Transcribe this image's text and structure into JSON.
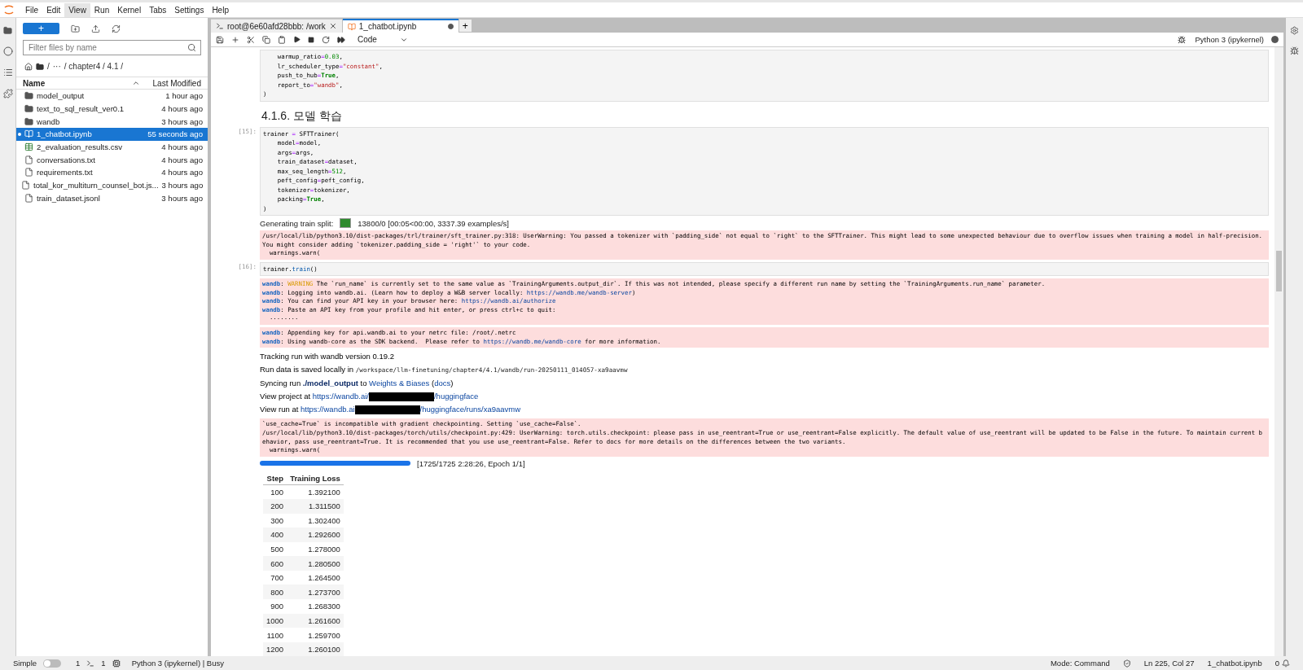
{
  "menu": [
    {
      "label": "File",
      "selected": false
    },
    {
      "label": "Edit",
      "selected": false
    },
    {
      "label": "View",
      "selected": true
    },
    {
      "label": "Run",
      "selected": false
    },
    {
      "label": "Kernel",
      "selected": false
    },
    {
      "label": "Tabs",
      "selected": false
    },
    {
      "label": "Settings",
      "selected": false
    },
    {
      "label": "Help",
      "selected": false
    }
  ],
  "file_browser": {
    "new_button": "+",
    "filter": {
      "placeholder": "Filter files by name"
    },
    "breadcrumb": [
      "/",
      "···",
      "/ chapter4 / 4.1 /"
    ],
    "columns": [
      "Name",
      "Last Modified"
    ],
    "files": [
      {
        "name": "model_output",
        "modified": "1 hour ago",
        "kind": "folder",
        "selected": false,
        "running": false
      },
      {
        "name": "text_to_sql_result_ver0.1",
        "modified": "4 hours ago",
        "kind": "folder",
        "selected": false,
        "running": false
      },
      {
        "name": "wandb",
        "modified": "3 hours ago",
        "kind": "folder",
        "selected": false,
        "running": false
      },
      {
        "name": "1_chatbot.ipynb",
        "modified": "55 seconds ago",
        "kind": "notebook",
        "selected": true,
        "running": true
      },
      {
        "name": "2_evaluation_results.csv",
        "modified": "4 hours ago",
        "kind": "csv",
        "selected": false,
        "running": false
      },
      {
        "name": "conversations.txt",
        "modified": "4 hours ago",
        "kind": "text",
        "selected": false,
        "running": false
      },
      {
        "name": "requirements.txt",
        "modified": "4 hours ago",
        "kind": "text",
        "selected": false,
        "running": false
      },
      {
        "name": "total_kor_multiturn_counsel_bot.js...",
        "modified": "3 hours ago",
        "kind": "text",
        "selected": false,
        "running": false
      },
      {
        "name": "train_dataset.jsonl",
        "modified": "3 hours ago",
        "kind": "text",
        "selected": false,
        "running": false
      }
    ]
  },
  "tabs": [
    {
      "label": "root@6e60afd28bbb: /work",
      "kind": "terminal",
      "selected": false,
      "dirty": false
    },
    {
      "label": "1_chatbot.ipynb",
      "kind": "notebook",
      "selected": true,
      "dirty": true
    }
  ],
  "add_tab": "+",
  "toolbar": {
    "cell_type": "Code",
    "kernel": "Python 3 (ipykernel)",
    "kernel_busy": true
  },
  "cells": [
    {
      "kind": "code",
      "lines": [
        [
          {
            "text": "    warmup_ratio",
            "kind": "name"
          },
          {
            "text": "=",
            "kind": "operator"
          },
          {
            "text": "0.03",
            "kind": "number"
          },
          {
            "text": ",",
            "kind": "name"
          }
        ],
        [
          {
            "text": "    lr_scheduler_type",
            "kind": "name"
          },
          {
            "text": "=",
            "kind": "operator"
          },
          {
            "text": "\"constant\"",
            "kind": "string"
          },
          {
            "text": ",",
            "kind": "name"
          }
        ],
        [
          {
            "text": "    push_to_hub",
            "kind": "name"
          },
          {
            "text": "=",
            "kind": "operator"
          },
          {
            "text": "True",
            "kind": "keyword"
          },
          {
            "text": ",",
            "kind": "name"
          }
        ],
        [
          {
            "text": "    report_to",
            "kind": "name"
          },
          {
            "text": "=",
            "kind": "operator"
          },
          {
            "text": "\"wandb\"",
            "kind": "string"
          },
          {
            "text": ",",
            "kind": "name"
          }
        ],
        [
          {
            "text": ")",
            "kind": "name"
          }
        ]
      ]
    },
    {
      "kind": "heading",
      "text": "4.1.6. 모델 학습"
    },
    {
      "kind": "code",
      "prompt": "[15]:",
      "lines": [
        [
          {
            "text": "trainer ",
            "kind": "name"
          },
          {
            "text": "=",
            "kind": "operator"
          },
          {
            "text": " SFTTrainer(",
            "kind": "name"
          }
        ],
        [
          {
            "text": "    model",
            "kind": "name"
          },
          {
            "text": "=",
            "kind": "operator"
          },
          {
            "text": "model,",
            "kind": "name"
          }
        ],
        [
          {
            "text": "    args",
            "kind": "name"
          },
          {
            "text": "=",
            "kind": "operator"
          },
          {
            "text": "args,",
            "kind": "name"
          }
        ],
        [
          {
            "text": "    train_dataset",
            "kind": "name"
          },
          {
            "text": "=",
            "kind": "operator"
          },
          {
            "text": "dataset,",
            "kind": "name"
          }
        ],
        [
          {
            "text": "    max_seq_length",
            "kind": "name"
          },
          {
            "text": "=",
            "kind": "operator"
          },
          {
            "text": "512",
            "kind": "number"
          },
          {
            "text": ",",
            "kind": "name"
          }
        ],
        [
          {
            "text": "    peft_config",
            "kind": "name"
          },
          {
            "text": "=",
            "kind": "operator"
          },
          {
            "text": "peft_config,",
            "kind": "name"
          }
        ],
        [
          {
            "text": "    tokenizer",
            "kind": "name"
          },
          {
            "text": "=",
            "kind": "operator"
          },
          {
            "text": "tokenizer,",
            "kind": "name"
          }
        ],
        [
          {
            "text": "    packing",
            "kind": "name"
          },
          {
            "text": "=",
            "kind": "operator"
          },
          {
            "text": "True",
            "kind": "keyword"
          },
          {
            "text": ",",
            "kind": "name"
          }
        ],
        [
          {
            "text": ")",
            "kind": "name"
          }
        ]
      ]
    },
    {
      "kind": "split_progress",
      "label": "Generating train split:",
      "level": 1,
      "text": "13800/0 [00:05<00:00, 3337.39 examples/s]"
    },
    {
      "kind": "stderr",
      "lines": [
        [
          {
            "text": "/usr/local/lib/python3.10/dist-packages/trl/trainer/sft_trainer.py:318: UserWarning: You passed a tokenizer with `padding_side` not equal to `right` to the SFTTrainer. This might lead to some unexpected behaviour due to overflow issues when training a model in half-precision.",
            "kind": "name"
          }
        ],
        [
          {
            "text": "You might consider adding `tokenizer.padding_side = 'right'` to your code.",
            "kind": "name"
          }
        ],
        [
          {
            "text": "  warnings.warn(",
            "kind": "name"
          }
        ]
      ]
    },
    {
      "kind": "code",
      "prompt": "[16]:",
      "lines": [
        [
          {
            "text": "trainer.",
            "kind": "name"
          },
          {
            "text": "train",
            "kind": "function"
          },
          {
            "text": "()",
            "kind": "name"
          }
        ]
      ]
    },
    {
      "kind": "stderr",
      "lines": [
        [
          {
            "text": "wandb",
            "kind": "wandb"
          },
          {
            "text": ": ",
            "kind": "name"
          },
          {
            "text": "WARNING",
            "kind": "warning"
          },
          {
            "text": " The `run_name` is currently set to the same value as `TrainingArguments.output_dir`. If this was not intended, please specify a different run name by setting the `TrainingArguments.run_name` parameter.",
            "kind": "name"
          }
        ],
        [
          {
            "text": "wandb",
            "kind": "wandb"
          },
          {
            "text": ": Logging into wandb.ai. (Learn how to deploy a W&B server locally: ",
            "kind": "name"
          },
          {
            "text": "https://wandb.me/wandb-server",
            "kind": "link"
          },
          {
            "text": ")",
            "kind": "name"
          }
        ],
        [
          {
            "text": "wandb",
            "kind": "wandb"
          },
          {
            "text": ": You can find your API key in your browser here: ",
            "kind": "name"
          },
          {
            "text": "https://wandb.ai/authorize",
            "kind": "link"
          }
        ],
        [
          {
            "text": "wandb",
            "kind": "wandb"
          },
          {
            "text": ": Paste an API key from your profile and hit enter, or press ctrl+c to quit:",
            "kind": "name"
          }
        ],
        [
          {
            "text": "  ········",
            "kind": "name"
          }
        ]
      ]
    },
    {
      "kind": "stderr",
      "lines": [
        [
          {
            "text": "wandb",
            "kind": "wandb"
          },
          {
            "text": ": Appending key for api.wandb.ai to your netrc file: /root/.netrc",
            "kind": "name"
          }
        ],
        [
          {
            "text": "wandb",
            "kind": "wandb"
          },
          {
            "text": ": Using wandb-core as the SDK backend.  Please refer to ",
            "kind": "name"
          },
          {
            "text": "https://wandb.me/wandb-core",
            "kind": "link"
          },
          {
            "text": " for more information.",
            "kind": "name"
          }
        ]
      ]
    },
    {
      "kind": "html",
      "lines": [
        [
          {
            "text": "Tracking run with wandb version 0.19.2",
            "kind": "name"
          }
        ],
        [
          {
            "text": "Run data is saved locally in ",
            "kind": "name"
          },
          {
            "text": "/workspace/llm-finetuning/chapter4/4.1/wandb/run-20250111_014057-xa9aavmw",
            "kind": "mono"
          }
        ],
        [
          {
            "text": "Syncing run ",
            "kind": "name"
          },
          {
            "text": "./model_output",
            "kind": "bold"
          },
          {
            "text": " to ",
            "kind": "name"
          },
          {
            "text": "Weights & Biases",
            "kind": "link"
          },
          {
            "text": " (",
            "kind": "name"
          },
          {
            "text": "docs",
            "kind": "link"
          },
          {
            "text": ")",
            "kind": "name"
          }
        ],
        [
          {
            "text": "View project at ",
            "kind": "name"
          },
          {
            "text": "https://wandb.ai/",
            "kind": "link"
          },
          {
            "kind": "redacted"
          },
          {
            "text": "/huggingface",
            "kind": "link"
          }
        ],
        [
          {
            "text": "View run at ",
            "kind": "name"
          },
          {
            "text": "https://wandb.ai",
            "kind": "link"
          },
          {
            "kind": "redacted"
          },
          {
            "text": "/huggingface/runs/xa9aavmw",
            "kind": "link"
          }
        ]
      ]
    },
    {
      "kind": "stderr",
      "lines": [
        [
          {
            "text": "`use_cache=True` is incompatible with gradient checkpointing. Setting `use_cache=False`.",
            "kind": "name"
          }
        ],
        [
          {
            "text": "/usr/local/lib/python3.10/dist-packages/torch/utils/checkpoint.py:429: UserWarning: torch.utils.checkpoint: please pass in use_reentrant=True or use_reentrant=False explicitly. The default value of use_reentrant will be updated to be False in the future. To maintain current b",
            "kind": "name"
          }
        ],
        [
          {
            "text": "ehavior, pass use_reentrant=True. It is recommended that you use use_reentrant=False. Refer to docs for more details on the differences between the two variants.",
            "kind": "name"
          }
        ],
        [
          {
            "text": "  warnings.warn(",
            "kind": "name"
          }
        ]
      ]
    },
    {
      "kind": "training_progress",
      "level": 1,
      "text": "[1725/1725 2:28:26, Epoch 1/1]"
    },
    {
      "kind": "table",
      "columns": [
        "Step",
        "Training Loss"
      ],
      "rows": [
        [
          "100",
          "1.392100"
        ],
        [
          "200",
          "1.311500"
        ],
        [
          "300",
          "1.302400"
        ],
        [
          "400",
          "1.292600"
        ],
        [
          "500",
          "1.278000"
        ],
        [
          "600",
          "1.280500"
        ],
        [
          "700",
          "1.264500"
        ],
        [
          "800",
          "1.273700"
        ],
        [
          "900",
          "1.268300"
        ],
        [
          "1000",
          "1.261600"
        ],
        [
          "1100",
          "1.259700"
        ],
        [
          "1200",
          "1.260100"
        ]
      ]
    }
  ],
  "status_bar": {
    "mode_label": "Simple",
    "simple_on": false,
    "terminals": "1",
    "kernels": "1",
    "kernel_status": "Python 3 (ipykernel) | Busy",
    "mode": "Mode: Command",
    "position": "Ln 225, Col 27",
    "file": "1_chatbot.ipynb",
    "notifications": "0"
  }
}
